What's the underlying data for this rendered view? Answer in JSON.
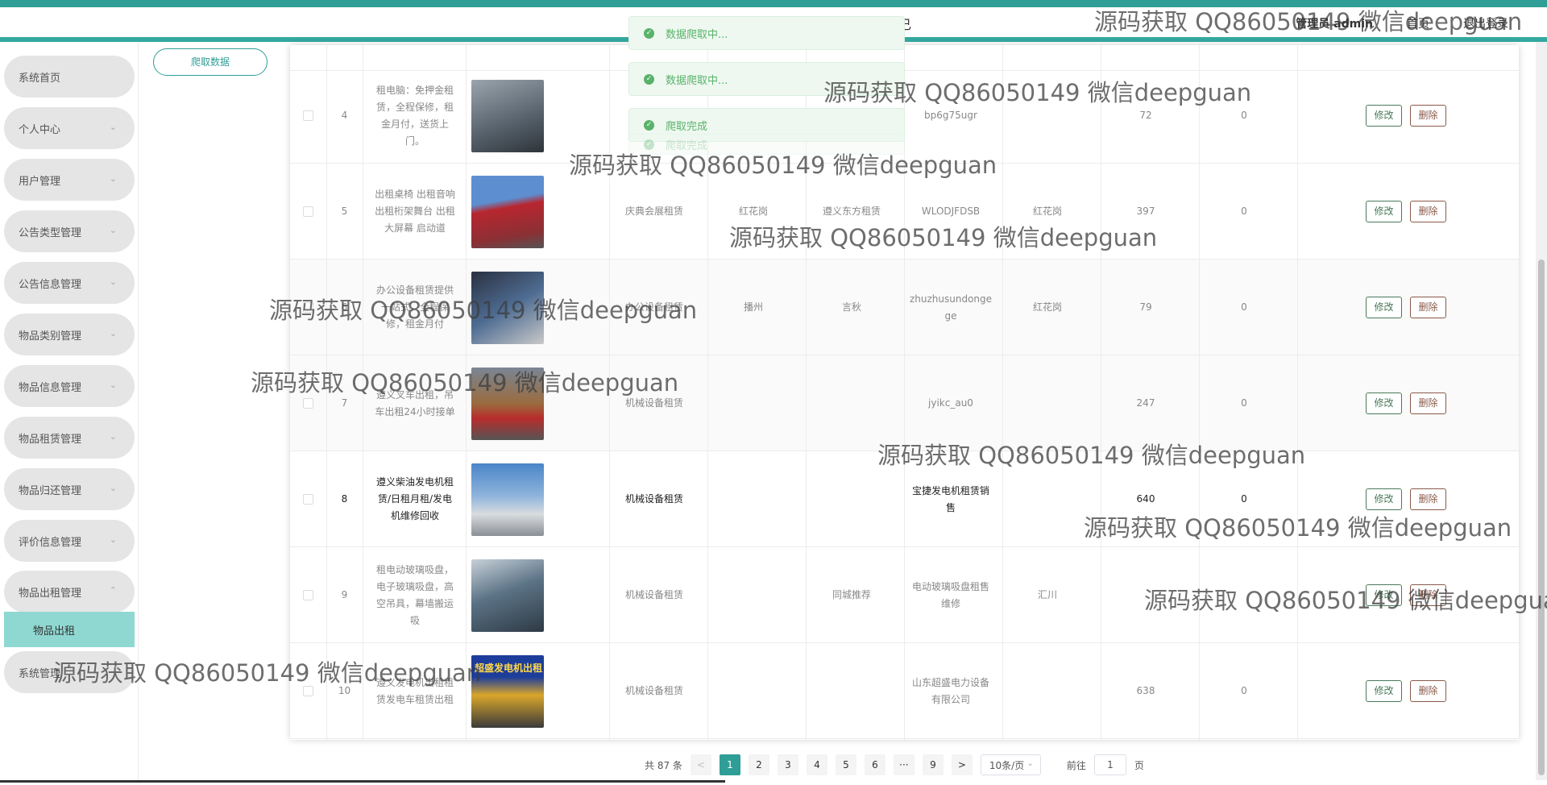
{
  "header": {
    "glyph": "己",
    "admin_label": "管理员 admin",
    "home_label": "首页",
    "logout_label": "退出登录"
  },
  "sidebar": {
    "items": [
      {
        "label": "系统首页",
        "expandable": false
      },
      {
        "label": "个人中心",
        "expandable": true
      },
      {
        "label": "用户管理",
        "expandable": true
      },
      {
        "label": "公告类型管理",
        "expandable": true
      },
      {
        "label": "公告信息管理",
        "expandable": true
      },
      {
        "label": "物品类别管理",
        "expandable": true
      },
      {
        "label": "物品信息管理",
        "expandable": true
      },
      {
        "label": "物品租赁管理",
        "expandable": true
      },
      {
        "label": "物品归还管理",
        "expandable": true
      },
      {
        "label": "评价信息管理",
        "expandable": true
      },
      {
        "label": "物品出租管理",
        "expandable": true,
        "expanded": true
      },
      {
        "label": "系统管理",
        "expandable": false
      }
    ],
    "subitem": "物品出租"
  },
  "toolbar": {
    "crawl_label": "爬取数据"
  },
  "toasts": [
    "数据爬取中...",
    "数据爬取中...",
    "爬取完成",
    "爬取完成"
  ],
  "table": {
    "rows": [
      {
        "index": "4",
        "title": "租电脑：免押金租赁，全程保修，租金月付，送货上门。",
        "category": "",
        "area": "",
        "source": "",
        "code": "bp6g75ugr",
        "addr": "",
        "price": "72",
        "stock": "0",
        "thumb_color": "#6e7a84",
        "style": "normal"
      },
      {
        "index": "5",
        "title": "出租桌椅 出租音响 出租桁架舞台 出租大屏幕 启动道",
        "category": "庆典会展租赁",
        "area": "红花岗",
        "source": "遵义东方租赁",
        "code": "WLODJFDSB",
        "addr": "红花岗",
        "price": "397",
        "stock": "0",
        "thumb_color": "#a8343b",
        "style": "normal"
      },
      {
        "index": "6",
        "title": "办公设备租赁提供一站式，全程保修，租金月付",
        "category": "办公设备租赁",
        "area": "播州",
        "source": "言秋",
        "code": "zhuzhusundonge ge",
        "addr": "红花岗",
        "price": "79",
        "stock": "0",
        "thumb_color": "#3c5a7a",
        "style": "alt"
      },
      {
        "index": "7",
        "title": "遵义叉车出租，吊车出租24小时接单",
        "category": "机械设备租赁",
        "area": "",
        "source": "",
        "code": "jyikc_au0",
        "addr": "",
        "price": "247",
        "stock": "0",
        "thumb_color": "#8a6a4a",
        "style": "alt"
      },
      {
        "index": "8",
        "title": "遵义柴油发电机租赁/日租月租/发电机维修回收",
        "category": "机械设备租赁",
        "area": "",
        "source": "",
        "code": "宝捷发电机租赁销售",
        "addr": "",
        "price": "640",
        "stock": "0",
        "thumb_color": "#5a8ab8",
        "style": "dark"
      },
      {
        "index": "9",
        "title": "租电动玻璃吸盘，电子玻璃吸盘，高空吊具，幕墙搬运吸",
        "category": "机械设备租赁",
        "area": "",
        "source": "同城推荐",
        "code": "电动玻璃吸盘租售维修",
        "addr": "汇川",
        "price": "",
        "stock": "",
        "thumb_color": "#4a6a7a",
        "style": "normal"
      },
      {
        "index": "10",
        "title": "遵义发电机出租租赁发电车租赁出租",
        "category": "机械设备租赁",
        "area": "",
        "source": "",
        "code": "山东超盛电力设备有限公司",
        "addr": "",
        "price": "638",
        "stock": "0",
        "thumb_color": "#1f3a8a",
        "style": "normal"
      }
    ],
    "edit_label": "修改",
    "delete_label": "删除",
    "thumb_caption_10": "超盛发电机出租"
  },
  "pagination": {
    "total": "共 87 条",
    "prev": "<",
    "pages": [
      "1",
      "2",
      "3",
      "4",
      "5",
      "6",
      "···",
      "9"
    ],
    "next": ">",
    "page_size": "10条/页",
    "goto_prefix": "前往",
    "goto_value": "1",
    "goto_suffix": "页",
    "active_color": "#2f9e96"
  },
  "watermark_text": "源码获取 QQ86050149 微信deepguan"
}
